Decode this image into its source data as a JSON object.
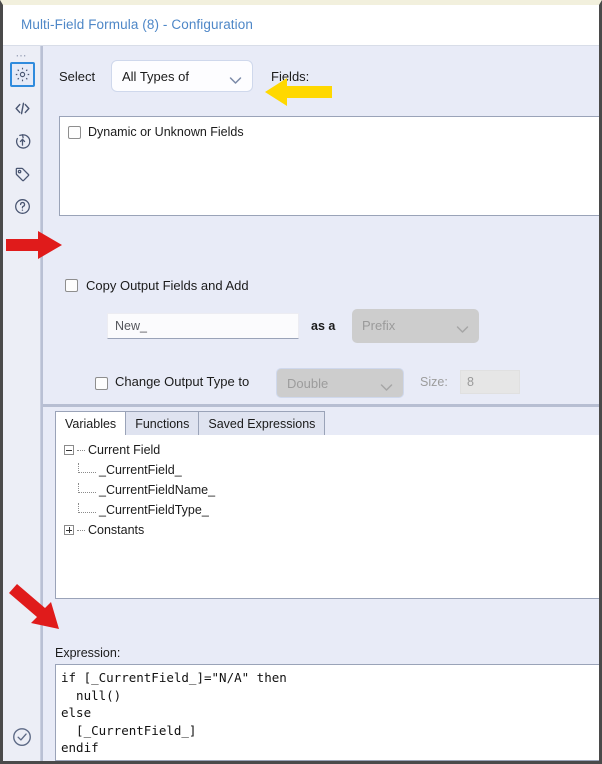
{
  "window": {
    "title": "Multi-Field Formula (8) - Configuration"
  },
  "rail": {
    "dots": "⋯",
    "items": [
      {
        "icon": "gear-icon",
        "selected": true
      },
      {
        "icon": "code-brackets-icon",
        "selected": false
      },
      {
        "icon": "arrow-in-circle-icon",
        "selected": false
      },
      {
        "icon": "tag-icon",
        "selected": false
      },
      {
        "icon": "question-mark-icon",
        "selected": false
      }
    ],
    "bottom_icon": "check-circle-icon"
  },
  "config": {
    "select_label": "Select",
    "type_dropdown_value": "All Types of",
    "fields_label": "Fields:",
    "fields_list": [
      {
        "label": "Dynamic or Unknown Fields",
        "checked": false
      }
    ],
    "copy_output": {
      "label": "Copy Output Fields and Add",
      "checked": false
    },
    "new_field": {
      "value": "New_",
      "as_a_label": "as a",
      "affix_value": "Prefix"
    },
    "change_output_type": {
      "label": "Change Output Type to",
      "checked": false,
      "type_value": "Double",
      "size_label": "Size:",
      "size_value": "8"
    }
  },
  "tabs": [
    {
      "label": "Variables",
      "active": true
    },
    {
      "label": "Functions",
      "active": false
    },
    {
      "label": "Saved Expressions",
      "active": false
    }
  ],
  "tree": {
    "root": {
      "label": "Current Field",
      "expanded": true
    },
    "children": [
      {
        "label": "_CurrentField_"
      },
      {
        "label": "_CurrentFieldName_"
      },
      {
        "label": "_CurrentFieldType_"
      }
    ],
    "second_root": {
      "label": "Constants",
      "expanded": false
    }
  },
  "expression": {
    "label": "Expression:",
    "value": "if [_CurrentField_]=\"N/A\" then\n  null()\nelse\n  [_CurrentField_]\nendif"
  },
  "annotations": [
    {
      "name": "yellow-arrow-fields",
      "color": "#FFD800",
      "direction": "left",
      "target": "Fields:"
    },
    {
      "name": "red-arrow-copy-output",
      "color": "#E01B1B",
      "direction": "right",
      "target": "Copy Output Fields and Add checkbox"
    },
    {
      "name": "red-arrow-expression",
      "color": "#E01B1B",
      "direction": "down-right",
      "target": "Expression:"
    }
  ],
  "colors": {
    "accent_blue": "#4e87c7",
    "panel_bg": "#e8ebf7",
    "rail_bg": "#eceef6",
    "annotation_yellow": "#FFD800",
    "annotation_red": "#E01B1B",
    "selection_blue": "#2f8bdd"
  }
}
